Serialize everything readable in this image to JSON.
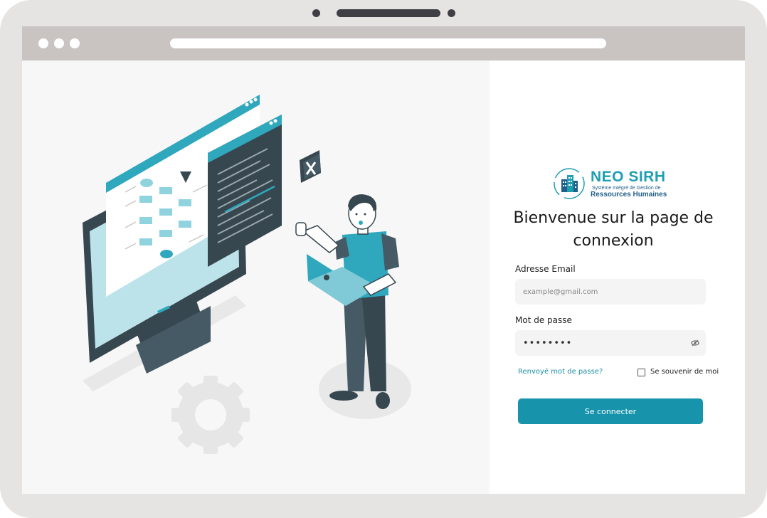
{
  "brand": {
    "name": "NEO SIRH",
    "subtitle_line1": "Système Intégré de Gestion de",
    "subtitle_line2": "Ressources Humaines"
  },
  "login": {
    "welcome": "Bienvenue sur la page de connexion",
    "email_label": "Adresse Email",
    "email_placeholder": "example@gmail.com",
    "password_label": "Mot de passe",
    "password_value": "••••••••",
    "forgot_password": "Renvoyé mot de passe?",
    "remember_me": "Se souvenir de moi",
    "submit": "Se connecter"
  },
  "colors": {
    "accent": "#1794ab",
    "illustration_teal": "#2fa7bd",
    "illustration_dark": "#37474f"
  }
}
